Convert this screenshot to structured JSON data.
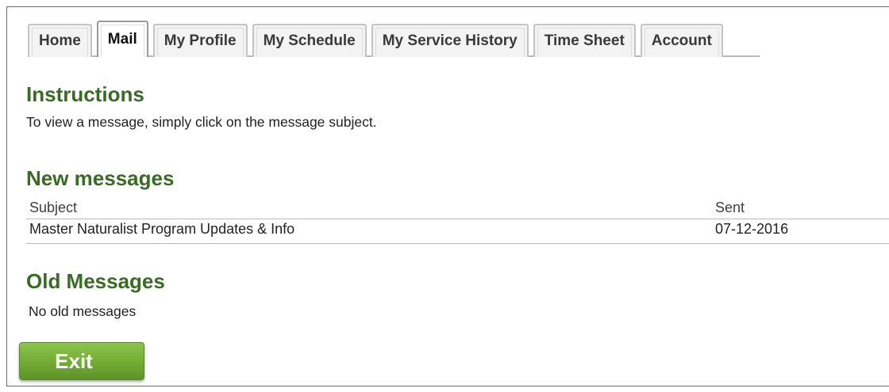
{
  "tabs": [
    {
      "label": "Home",
      "active": false
    },
    {
      "label": "Mail",
      "active": true
    },
    {
      "label": "My Profile",
      "active": false
    },
    {
      "label": "My Schedule",
      "active": false
    },
    {
      "label": "My Service History",
      "active": false
    },
    {
      "label": "Time Sheet",
      "active": false
    },
    {
      "label": "Account",
      "active": false
    }
  ],
  "instructions": {
    "title": "Instructions",
    "text": "To view a message, simply click on the message subject."
  },
  "new_messages": {
    "title": "New messages",
    "columns": {
      "subject": "Subject",
      "sent": "Sent"
    },
    "rows": [
      {
        "subject": "Master Naturalist Program Updates & Info",
        "sent": "07-12-2016"
      }
    ]
  },
  "old_messages": {
    "title": "Old Messages",
    "empty_text": "No old messages"
  },
  "exit_button": {
    "label": "Exit"
  },
  "colors": {
    "heading_green": "#3a6b24",
    "button_green": "#74ad36"
  }
}
